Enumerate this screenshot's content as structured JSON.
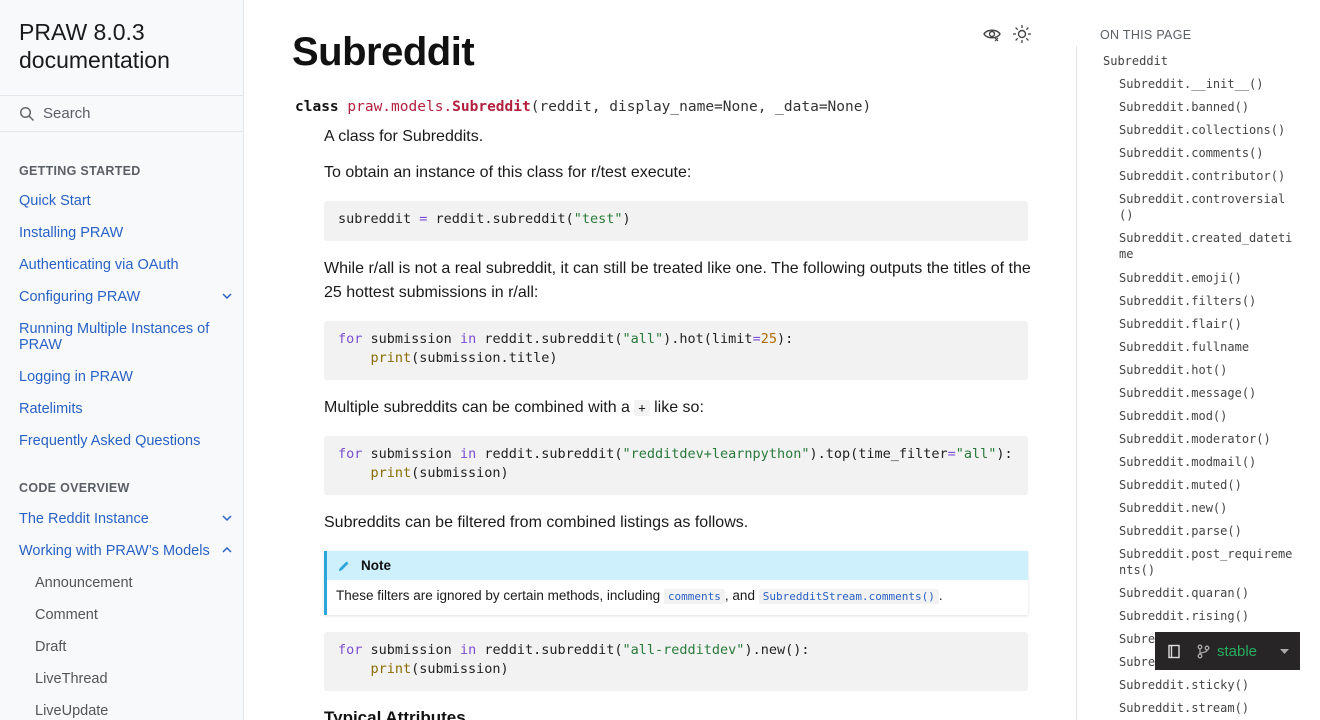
{
  "sidebar": {
    "brand": "PRAW 8.0.3 documentation",
    "search_placeholder": "Search",
    "getting_started_caption": "GETTING STARTED",
    "getting_started": [
      "Quick Start",
      "Installing PRAW",
      "Authenticating via OAuth",
      "Configuring PRAW",
      "Running Multiple Instances of PRAW",
      "Logging in PRAW",
      "Ratelimits",
      "Frequently Asked Questions"
    ],
    "code_overview_caption": "CODE OVERVIEW",
    "code_overview": [
      "The Reddit Instance",
      "Working with PRAW’s Models"
    ],
    "models": [
      "Announcement",
      "Comment",
      "Draft",
      "LiveThread",
      "LiveUpdate"
    ]
  },
  "main": {
    "title": "Subreddit",
    "signature": {
      "keyword": "class",
      "module": "praw.models.",
      "name": "Subreddit",
      "params": "(reddit, display_name=None, _data=None)"
    },
    "intro": "A class for Subreddits.",
    "p_instance": "To obtain an instance of this class for r/test execute:",
    "p_all": "While r/all is not a real subreddit, it can still be treated like one. The following outputs the titles of the 25 hottest submissions in r/all:",
    "p_multi_before": "Multiple subreddits can be combined with a",
    "p_multi_code": "+",
    "p_multi_after": "like so:",
    "p_filter": "Subreddits can be filtered from combined listings as follows.",
    "note": {
      "title": "Note",
      "text_before": "These filters are ignored by certain methods, including",
      "code1": "comments",
      "text_mid": ", and",
      "code2": "SubredditStream.comments()",
      "text_end": "."
    },
    "heading_next": "Typical Attributes"
  },
  "toc": {
    "caption": "ON THIS PAGE",
    "root": "Subreddit",
    "items": [
      "Subreddit.__init__()",
      "Subreddit.banned()",
      "Subreddit.collections()",
      "Subreddit.comments()",
      "Subreddit.contributor()",
      "Subreddit.controversial()",
      "Subreddit.created_datetime",
      "Subreddit.emoji()",
      "Subreddit.filters()",
      "Subreddit.flair()",
      "Subreddit.fullname",
      "Subreddit.hot()",
      "Subreddit.message()",
      "Subreddit.mod()",
      "Subreddit.moderator()",
      "Subreddit.modmail()",
      "Subreddit.muted()",
      "Subreddit.new()",
      "Subreddit.parse()",
      "Subreddit.post_requirements()",
      "Subreddit.quaran()",
      "Subreddit.rising()",
      "Subre",
      "Subre",
      "Subreddit.sticky()",
      "Subreddit.stream()"
    ]
  },
  "version_badge": {
    "label": "stable"
  },
  "colors": {
    "link": "#2962c4",
    "note_accent": "#2aa6d8",
    "badge_green": "#27ae60"
  }
}
